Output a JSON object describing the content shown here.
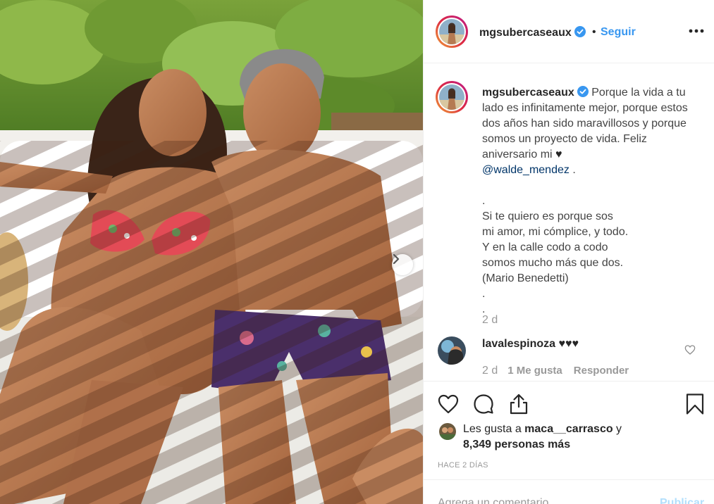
{
  "post": {
    "author": "mgsubercaseaux",
    "follow_label": "Seguir",
    "separator": "•",
    "caption_line_1": "Porque la vida a tu lado es infinitamente mejor, porque estos dos años han sido maravillosos y porque somos un proyecto de vida. Feliz aniversario mi ",
    "caption_heart": "♥",
    "caption_mention": "@walde_mendez",
    "caption_end": " .",
    "poem": [
      ".",
      "Si te quiero es porque sos",
      "mi amor, mi cómplice, y todo.",
      "Y en la calle codo a codo",
      "somos mucho más que dos.",
      "(Mario Benedetti)",
      ".",
      "."
    ],
    "caption_time": "2 d"
  },
  "reply": {
    "user": "lavalespinoza",
    "text": "♥♥♥",
    "time": "2 d",
    "likes": "1 Me gusta",
    "respond": "Responder"
  },
  "likes": {
    "prefix": "Les gusta a ",
    "user": "maca__carrasco",
    "suffix": " y",
    "others": "8,349 personas más"
  },
  "timestamp": "HACE 2 DÍAS",
  "comment_box": {
    "placeholder": "Agrega un comentario...",
    "publish_label": "Publicar"
  },
  "colors": {
    "link": "#3897f0",
    "mention": "#003569",
    "muted": "#999999",
    "publish_disabled": "#b2dffc"
  },
  "icons": [
    "verified-badge-icon",
    "more-options-icon",
    "chevron-right-icon",
    "heart-icon",
    "comment-icon",
    "share-icon",
    "bookmark-icon",
    "heart-small-icon"
  ]
}
